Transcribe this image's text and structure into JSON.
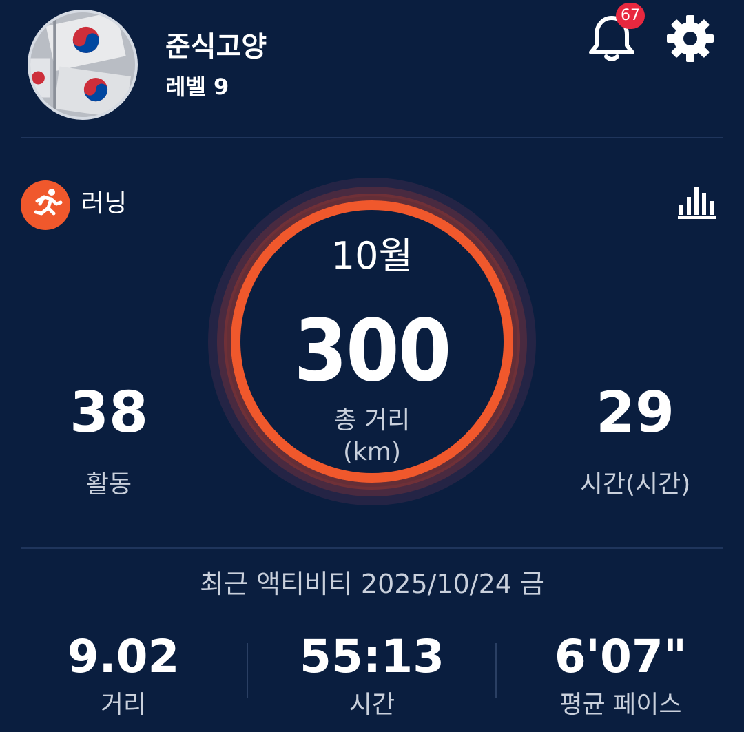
{
  "profile": {
    "username": "준식고양",
    "level": "레벨 9",
    "avatar_icon": "korean-flag-avatar"
  },
  "header": {
    "notification_icon": "bell-icon",
    "notification_count": "67",
    "settings_icon": "gear-icon"
  },
  "activity": {
    "type_label": "러닝",
    "type_icon": "running-icon",
    "stats_icon": "bar-chart-icon"
  },
  "summary": {
    "month": "10월",
    "total_distance": "300",
    "total_distance_label": "총 거리",
    "total_distance_unit": "(km)",
    "activities_value": "38",
    "activities_label": "활동",
    "time_value": "29",
    "time_label": "시간(시간)"
  },
  "recent": {
    "title": "최근 액티비티 2025/10/24 금",
    "distance_value": "9.02",
    "distance_label": "거리",
    "time_value": "55:13",
    "time_label": "시간",
    "pace_value": "6'07\"",
    "pace_label": "평균 페이스"
  },
  "colors": {
    "background": "#0a1e3f",
    "ring_accent": "#f0582c",
    "badge": "#e8283f"
  }
}
